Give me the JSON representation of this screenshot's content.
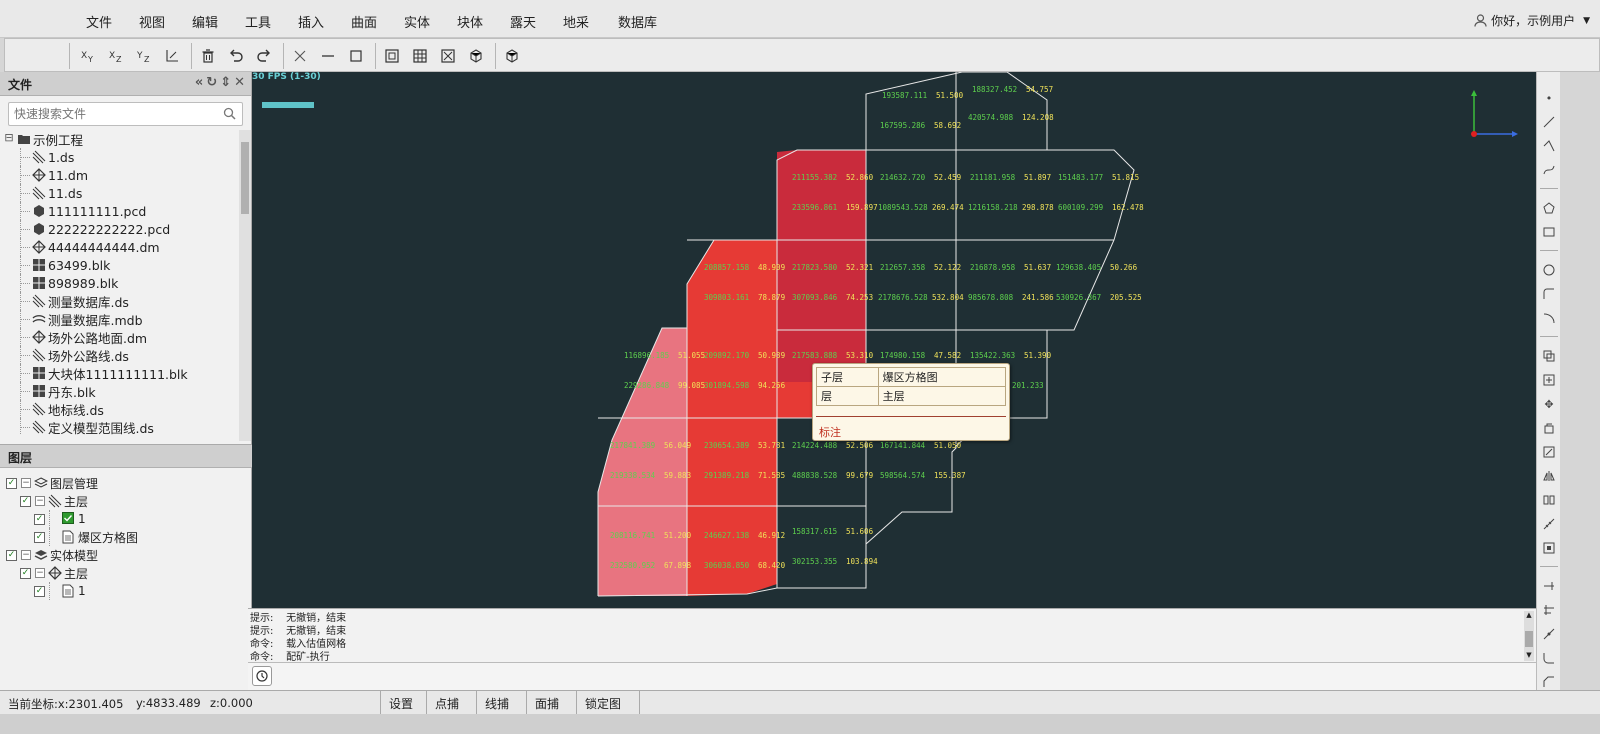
{
  "menu": {
    "items": [
      "文件",
      "视图",
      "编辑",
      "工具",
      "插入",
      "曲面",
      "实体",
      "块体",
      "露天",
      "地采",
      "数据库"
    ],
    "user_greeting": "你好，示例用户"
  },
  "toolbar": {
    "buttons": [
      "view-xy",
      "view-xz",
      "view-yz",
      "view-axis",
      "delete",
      "undo",
      "redo",
      "cross",
      "line",
      "rect",
      "grid-box",
      "grid",
      "grid-x",
      "cube-rotate",
      "cube"
    ],
    "view_xy_label": "XY",
    "view_xz_label": "XZ",
    "view_yz_label": "YZ"
  },
  "file_panel": {
    "title": "文件",
    "search_placeholder": "快速搜索文件",
    "root": "示例工程",
    "files": [
      {
        "name": "1.ds",
        "icon": "ds-icon"
      },
      {
        "name": "11.dm",
        "icon": "dm-icon"
      },
      {
        "name": "11.ds",
        "icon": "ds-icon"
      },
      {
        "name": "111111111.pcd",
        "icon": "pcd-icon"
      },
      {
        "name": "222222222222.pcd",
        "icon": "pcd-icon"
      },
      {
        "name": "44444444444.dm",
        "icon": "dm-icon"
      },
      {
        "name": "63499.blk",
        "icon": "blk-icon"
      },
      {
        "name": "898989.blk",
        "icon": "blk-icon"
      },
      {
        "name": "测量数据库.ds",
        "icon": "ds-icon"
      },
      {
        "name": "测量数据库.mdb",
        "icon": "mdb-icon"
      },
      {
        "name": "场外公路地面.dm",
        "icon": "dm-icon"
      },
      {
        "name": "场外公路线.ds",
        "icon": "ds-icon"
      },
      {
        "name": "大块体1111111111.blk",
        "icon": "blk-icon"
      },
      {
        "name": "丹东.blk",
        "icon": "blk-icon"
      },
      {
        "name": "地标线.ds",
        "icon": "ds-icon"
      },
      {
        "name": "定义模型范围线.ds",
        "icon": "ds-icon"
      }
    ]
  },
  "layer_panel": {
    "title": "图层",
    "tree": [
      {
        "label": "图层管理",
        "level": 0,
        "expander": true,
        "icon": "layers-icon"
      },
      {
        "label": "主层",
        "level": 1,
        "expander": true,
        "icon": "ds-icon"
      },
      {
        "label": "1",
        "level": 2,
        "expander": false,
        "icon": "green-check-icon"
      },
      {
        "label": "爆区方格图",
        "level": 2,
        "expander": false,
        "icon": "doc-icon"
      },
      {
        "label": "实体模型",
        "level": 0,
        "expander": true,
        "icon": "solid-layers-icon"
      },
      {
        "label": "主层",
        "level": 1,
        "expander": true,
        "icon": "dm-icon"
      },
      {
        "label": "1",
        "level": 2,
        "expander": false,
        "icon": "doc-icon"
      }
    ]
  },
  "viewport": {
    "fps": "30 FPS (1-30)",
    "labels": [
      {
        "a": "193587.111",
        "b": "51.500"
      },
      {
        "a": "188327.452",
        "b": "54.757"
      },
      {
        "a": "167595.286",
        "b": "58.692"
      },
      {
        "a": "420574.988",
        "b": "124.208"
      },
      {
        "a": "211155.382",
        "b": "52.860"
      },
      {
        "a": "214632.720",
        "b": "52.459"
      },
      {
        "a": "211181.958",
        "b": "51.897"
      },
      {
        "a": "151483.177",
        "b": "51.815"
      },
      {
        "a": "233596.861",
        "b": "159.897"
      },
      {
        "a": "1089543.528",
        "b": "269.474"
      },
      {
        "a": "1216158.218",
        "b": "298.878"
      },
      {
        "a": "600109.299",
        "b": "162.478"
      },
      {
        "a": "208857.158",
        "b": "48.909"
      },
      {
        "a": "217823.580",
        "b": "52.321"
      },
      {
        "a": "212657.358",
        "b": "52.122"
      },
      {
        "a": "216878.958",
        "b": "51.637"
      },
      {
        "a": "129638.405",
        "b": "50.266"
      },
      {
        "a": "309803.161",
        "b": "78.879"
      },
      {
        "a": "307093.846",
        "b": "74.253"
      },
      {
        "a": "2178676.528",
        "b": "532.804"
      },
      {
        "a": "985678.808",
        "b": "241.586"
      },
      {
        "a": "530926.367",
        "b": "205.525"
      },
      {
        "a": "116896.185",
        "b": "51.055"
      },
      {
        "a": "209892.170",
        "b": "50.939"
      },
      {
        "a": "217583.888",
        "b": "53.310"
      },
      {
        "a": "174980.158",
        "b": "47.582"
      },
      {
        "a": "135422.363",
        "b": "51.390"
      },
      {
        "a": "229286.848",
        "b": "99.085"
      },
      {
        "a": "301894.598",
        "b": "94.256"
      },
      {
        "a": "201.233",
        "b": ""
      },
      {
        "a": "217841.389",
        "b": "56.049"
      },
      {
        "a": "230654.389",
        "b": "53.731"
      },
      {
        "a": "214224.488",
        "b": "52.506"
      },
      {
        "a": "167141.844",
        "b": "51.050"
      },
      {
        "a": "219338.534",
        "b": "59.883"
      },
      {
        "a": "291389.218",
        "b": "71.585"
      },
      {
        "a": "488838.528",
        "b": "99.679"
      },
      {
        "a": "598564.574",
        "b": "155.387"
      },
      {
        "a": "208116.741",
        "b": "51.200"
      },
      {
        "a": "246627.138",
        "b": "46.912"
      },
      {
        "a": "158317.615",
        "b": "51.606"
      },
      {
        "a": "232580.952",
        "b": "67.898"
      },
      {
        "a": "306038.850",
        "b": "68.420"
      },
      {
        "a": "302153.355",
        "b": "103.894"
      }
    ],
    "tooltip": {
      "rows": [
        [
          "子层",
          "爆区方格图"
        ],
        [
          "层",
          "主层"
        ]
      ],
      "label": "标注"
    },
    "colors": {
      "background": "#1f2f34",
      "red": "#e63a35",
      "dark_red": "#c92b3c",
      "pink": "#e87480",
      "grid_line": "#e0e0e0"
    }
  },
  "command": {
    "lines": [
      "提示:    无撤销，结束",
      "提示:    无撤销，结束",
      "命令:    载入估值网格",
      "命令:    配矿-执行"
    ]
  },
  "status": {
    "coord_label": "当前坐标:x:2301.405",
    "y": "y:4833.489",
    "z": "z:0.000",
    "buttons": [
      "设置",
      "点捕捉",
      "线捕捉",
      "面捕捉",
      "锁定图层"
    ]
  }
}
